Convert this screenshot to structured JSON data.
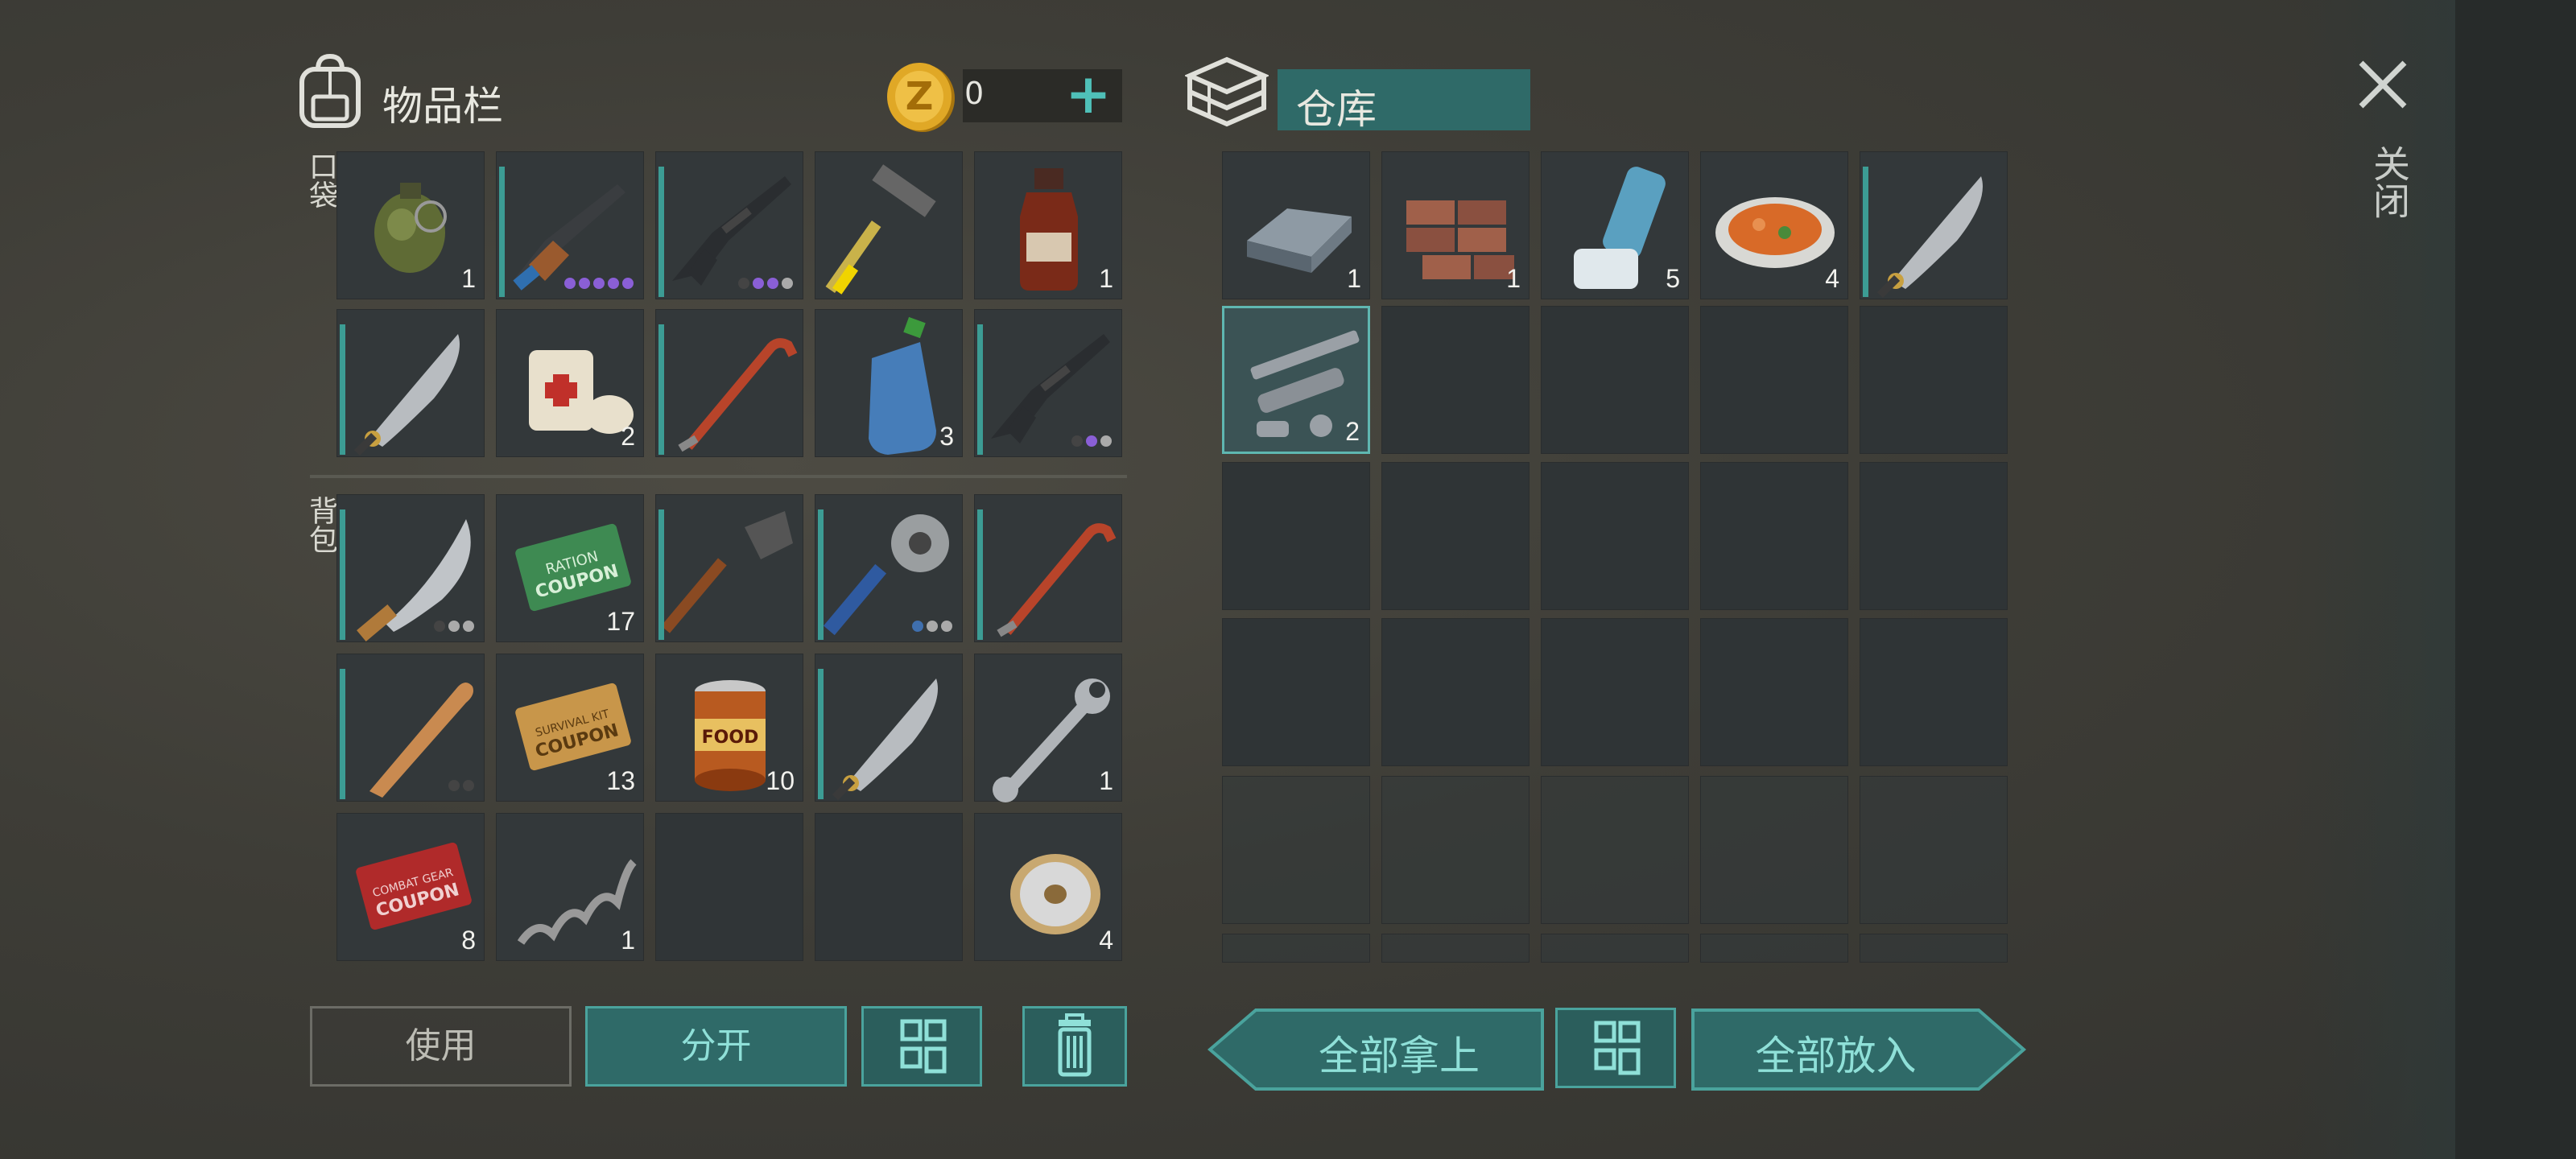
{
  "inventory": {
    "title": "物品栏",
    "coin_value": "0",
    "pocket_label": "口袋",
    "backpack_label": "背包",
    "pocket_slots": [
      {
        "item": "grenade",
        "qty": "1"
      },
      {
        "item": "ak-rifle",
        "qty": "",
        "dots": [
          "#8a5fd6",
          "#8a5fd6",
          "#8a5fd6",
          "#8a5fd6",
          "#8a5fd6"
        ],
        "accent": true
      },
      {
        "item": "m4-rifle",
        "qty": "",
        "dots": [
          "#444",
          "#8a5fd6",
          "#8a5fd6",
          "#aaa"
        ],
        "accent": true
      },
      {
        "item": "hammer",
        "qty": ""
      },
      {
        "item": "bottle",
        "qty": "1"
      },
      {
        "item": "machete",
        "qty": "",
        "accent": true
      },
      {
        "item": "bandage",
        "qty": "2"
      },
      {
        "item": "crowbar",
        "qty": "",
        "accent": true
      },
      {
        "item": "water-bottle",
        "qty": "3"
      },
      {
        "item": "m4-rifle",
        "qty": "",
        "dots": [
          "#444",
          "#8a5fd6",
          "#aaa"
        ],
        "accent": true
      }
    ],
    "backpack_slots": [
      {
        "item": "machete-large",
        "qty": "",
        "dots": [
          "#444",
          "#aaa",
          "#aaa"
        ],
        "accent": true
      },
      {
        "item": "ration-coupon",
        "qty": "17"
      },
      {
        "item": "shovel",
        "qty": "",
        "accent": true
      },
      {
        "item": "saw-club",
        "qty": "",
        "dots": [
          "#3f6fae",
          "#aaa",
          "#aaa"
        ],
        "accent": true
      },
      {
        "item": "crowbar",
        "qty": "",
        "accent": true
      },
      {
        "item": "baseball-bat",
        "qty": "",
        "dots": [
          "#444",
          "#444"
        ],
        "accent": true
      },
      {
        "item": "survival-coupon",
        "qty": "13"
      },
      {
        "item": "canned-food",
        "qty": "10"
      },
      {
        "item": "machete",
        "qty": "",
        "accent": true
      },
      {
        "item": "wrench",
        "qty": "1"
      },
      {
        "item": "combat-coupon",
        "qty": "8"
      },
      {
        "item": "spring",
        "qty": "1"
      },
      {
        "item": "",
        "qty": ""
      },
      {
        "item": "",
        "qty": ""
      },
      {
        "item": "wire-spool",
        "qty": "4"
      }
    ],
    "buttons": {
      "use": "使用",
      "split": "分开"
    }
  },
  "warehouse": {
    "title": "仓库",
    "slots": [
      {
        "item": "iron-ingot",
        "qty": "1"
      },
      {
        "item": "bricks",
        "qty": "1"
      },
      {
        "item": "inhaler",
        "qty": "5"
      },
      {
        "item": "food-plate",
        "qty": "4"
      },
      {
        "item": "machete",
        "qty": "",
        "accent": true
      },
      {
        "item": "pipe-parts",
        "qty": "2",
        "selected": true
      }
    ],
    "buttons": {
      "take_all": "全部拿上",
      "put_all": "全部放入"
    }
  },
  "close_label": "关闭",
  "colors": {
    "accent": "#3c9c94",
    "button_text": "#8fe0d8",
    "button_bg": "#2f6a68"
  }
}
